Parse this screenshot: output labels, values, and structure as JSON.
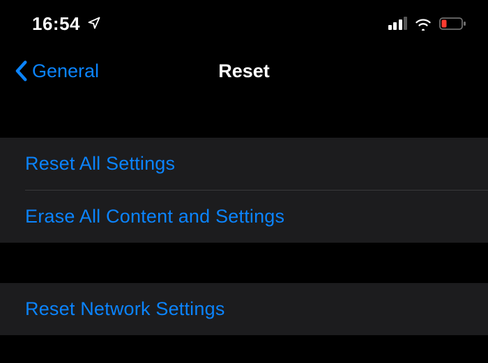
{
  "statusBar": {
    "time": "16:54",
    "locationIconName": "location-arrow-icon",
    "signalStrength": 3,
    "wifiName": "wifi-icon",
    "batteryName": "battery-low-icon",
    "batteryColor": "#ff3b30"
  },
  "nav": {
    "backLabel": "General",
    "title": "Reset"
  },
  "section1": {
    "items": [
      {
        "label": "Reset All Settings"
      },
      {
        "label": "Erase All Content and Settings"
      }
    ]
  },
  "section2": {
    "items": [
      {
        "label": "Reset Network Settings"
      }
    ]
  },
  "colors": {
    "link": "#0b84ff",
    "background": "#000000",
    "cellBackground": "#1c1c1e"
  }
}
